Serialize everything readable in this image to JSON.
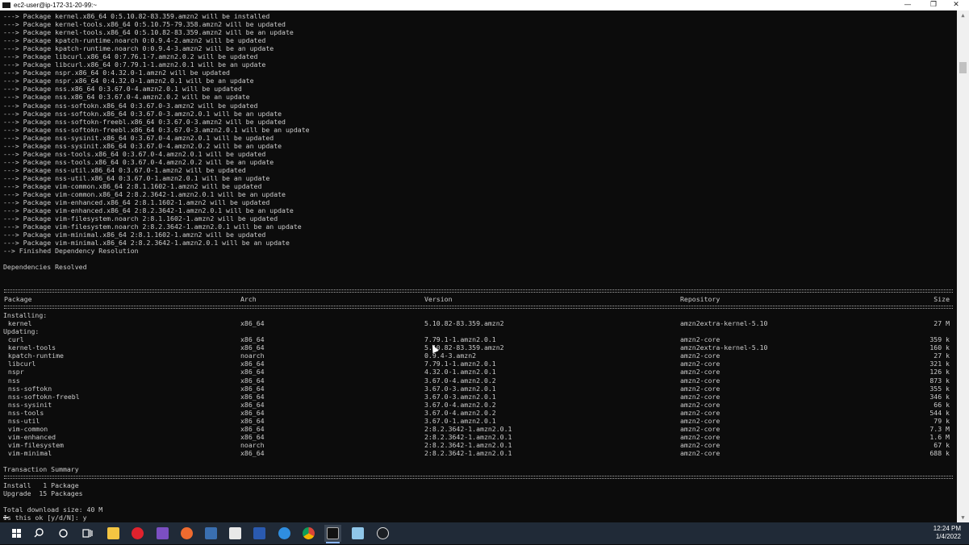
{
  "window": {
    "title": "ec2-user@ip-172-31-20-99:~",
    "minimize_glyph": "—",
    "maximize_glyph": "❐",
    "close_glyph": "✕"
  },
  "terminal": {
    "lines": [
      "---> Package kernel.x86_64 0:5.10.82-83.359.amzn2 will be installed",
      "---> Package kernel-tools.x86_64 0:5.10.75-79.358.amzn2 will be updated",
      "---> Package kernel-tools.x86_64 0:5.10.82-83.359.amzn2 will be an update",
      "---> Package kpatch-runtime.noarch 0:0.9.4-2.amzn2 will be updated",
      "---> Package kpatch-runtime.noarch 0:0.9.4-3.amzn2 will be an update",
      "---> Package libcurl.x86_64 0:7.76.1-7.amzn2.0.2 will be updated",
      "---> Package libcurl.x86_64 0:7.79.1-1.amzn2.0.1 will be an update",
      "---> Package nspr.x86_64 0:4.32.0-1.amzn2 will be updated",
      "---> Package nspr.x86_64 0:4.32.0-1.amzn2.0.1 will be an update",
      "---> Package nss.x86_64 0:3.67.0-4.amzn2.0.1 will be updated",
      "---> Package nss.x86_64 0:3.67.0-4.amzn2.0.2 will be an update",
      "---> Package nss-softokn.x86_64 0:3.67.0-3.amzn2 will be updated",
      "---> Package nss-softokn.x86_64 0:3.67.0-3.amzn2.0.1 will be an update",
      "---> Package nss-softokn-freebl.x86_64 0:3.67.0-3.amzn2 will be updated",
      "---> Package nss-softokn-freebl.x86_64 0:3.67.0-3.amzn2.0.1 will be an update",
      "---> Package nss-sysinit.x86_64 0:3.67.0-4.amzn2.0.1 will be updated",
      "---> Package nss-sysinit.x86_64 0:3.67.0-4.amzn2.0.2 will be an update",
      "---> Package nss-tools.x86_64 0:3.67.0-4.amzn2.0.1 will be updated",
      "---> Package nss-tools.x86_64 0:3.67.0-4.amzn2.0.2 will be an update",
      "---> Package nss-util.x86_64 0:3.67.0-1.amzn2 will be updated",
      "---> Package nss-util.x86_64 0:3.67.0-1.amzn2.0.1 will be an update",
      "---> Package vim-common.x86_64 2:8.1.1602-1.amzn2 will be updated",
      "---> Package vim-common.x86_64 2:8.2.3642-1.amzn2.0.1 will be an update",
      "---> Package vim-enhanced.x86_64 2:8.1.1602-1.amzn2 will be updated",
      "---> Package vim-enhanced.x86_64 2:8.2.3642-1.amzn2.0.1 will be an update",
      "---> Package vim-filesystem.noarch 2:8.1.1602-1.amzn2 will be updated",
      "---> Package vim-filesystem.noarch 2:8.2.3642-1.amzn2.0.1 will be an update",
      "---> Package vim-minimal.x86_64 2:8.1.1602-1.amzn2 will be updated",
      "---> Package vim-minimal.x86_64 2:8.2.3642-1.amzn2.0.1 will be an update",
      "--> Finished Dependency Resolution",
      "",
      "Dependencies Resolved"
    ],
    "table": {
      "headers": {
        "package": "Package",
        "arch": "Arch",
        "version": "Version",
        "repository": "Repository",
        "size": "Size"
      },
      "installing_label": "Installing:",
      "updating_label": "Updating:",
      "installing": [
        {
          "package": " kernel",
          "arch": "x86_64",
          "version": "5.10.82-83.359.amzn2",
          "repository": "amzn2extra-kernel-5.10",
          "size": "27 M"
        }
      ],
      "updating": [
        {
          "package": " curl",
          "arch": "x86_64",
          "version": "7.79.1-1.amzn2.0.1",
          "repository": "amzn2-core",
          "size": "359 k"
        },
        {
          "package": " kernel-tools",
          "arch": "x86_64",
          "version": "5.10.82-83.359.amzn2",
          "repository": "amzn2extra-kernel-5.10",
          "size": "160 k"
        },
        {
          "package": " kpatch-runtime",
          "arch": "noarch",
          "version": "0.9.4-3.amzn2",
          "repository": "amzn2-core",
          "size": "27 k"
        },
        {
          "package": " libcurl",
          "arch": "x86_64",
          "version": "7.79.1-1.amzn2.0.1",
          "repository": "amzn2-core",
          "size": "321 k"
        },
        {
          "package": " nspr",
          "arch": "x86_64",
          "version": "4.32.0-1.amzn2.0.1",
          "repository": "amzn2-core",
          "size": "126 k"
        },
        {
          "package": " nss",
          "arch": "x86_64",
          "version": "3.67.0-4.amzn2.0.2",
          "repository": "amzn2-core",
          "size": "873 k"
        },
        {
          "package": " nss-softokn",
          "arch": "x86_64",
          "version": "3.67.0-3.amzn2.0.1",
          "repository": "amzn2-core",
          "size": "355 k"
        },
        {
          "package": " nss-softokn-freebl",
          "arch": "x86_64",
          "version": "3.67.0-3.amzn2.0.1",
          "repository": "amzn2-core",
          "size": "346 k"
        },
        {
          "package": " nss-sysinit",
          "arch": "x86_64",
          "version": "3.67.0-4.amzn2.0.2",
          "repository": "amzn2-core",
          "size": "66 k"
        },
        {
          "package": " nss-tools",
          "arch": "x86_64",
          "version": "3.67.0-4.amzn2.0.2",
          "repository": "amzn2-core",
          "size": "544 k"
        },
        {
          "package": " nss-util",
          "arch": "x86_64",
          "version": "3.67.0-1.amzn2.0.1",
          "repository": "amzn2-core",
          "size": "79 k"
        },
        {
          "package": " vim-common",
          "arch": "x86_64",
          "version": "2:8.2.3642-1.amzn2.0.1",
          "repository": "amzn2-core",
          "size": "7.3 M"
        },
        {
          "package": " vim-enhanced",
          "arch": "x86_64",
          "version": "2:8.2.3642-1.amzn2.0.1",
          "repository": "amzn2-core",
          "size": "1.6 M"
        },
        {
          "package": " vim-filesystem",
          "arch": "noarch",
          "version": "2:8.2.3642-1.amzn2.0.1",
          "repository": "amzn2-core",
          "size": "67 k"
        },
        {
          "package": " vim-minimal",
          "arch": "x86_64",
          "version": "2:8.2.3642-1.amzn2.0.1",
          "repository": "amzn2-core",
          "size": "688 k"
        }
      ]
    },
    "summary": {
      "title": "Transaction Summary",
      "install": "Install   1 Package",
      "upgrade": "Upgrade  15 Packages",
      "download": "Total download size: 40 M",
      "prompt": "Is this ok [y/d/N]: y"
    }
  },
  "taskbar": {
    "apps": [
      "start-icon",
      "search-icon",
      "cortana-icon",
      "task-view-icon",
      "file-explorer-icon",
      "opera-icon",
      "visual-studio-icon",
      "postman-icon",
      "remote-desktop-icon",
      "app-icon",
      "powershell-icon",
      "browser-icon",
      "chrome-icon",
      "terminal-icon",
      "notepad-icon",
      "github-icon"
    ],
    "time": "12:24 PM",
    "date": "1/4/2022"
  },
  "colors": {
    "terminal_bg": "#0c0c0c",
    "terminal_fg": "#cccccc",
    "taskbar_bg": "#202a37"
  }
}
